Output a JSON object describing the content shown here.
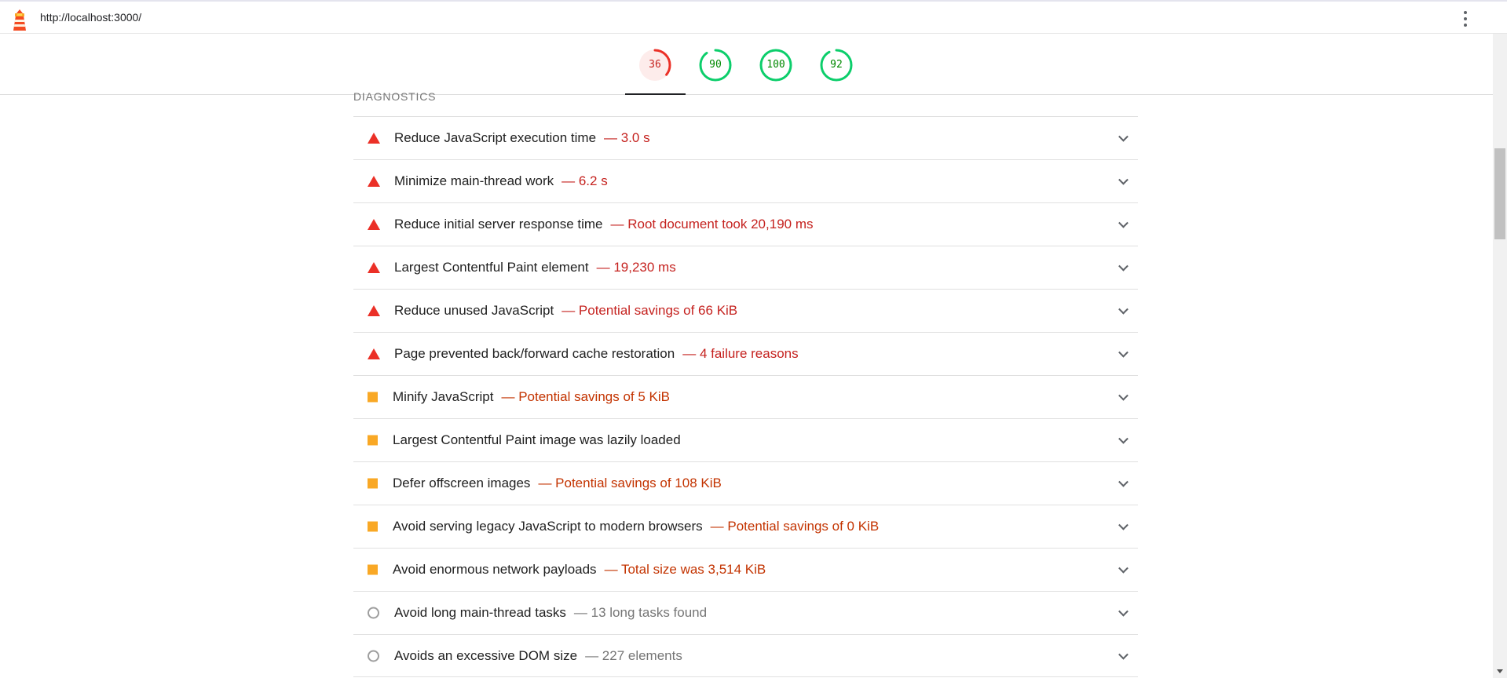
{
  "header": {
    "url": "http://localhost:3000/"
  },
  "scores": [
    {
      "value": "36",
      "fraction": 0.36,
      "status": "fail",
      "color": "#eb3027"
    },
    {
      "value": "90",
      "fraction": 0.9,
      "status": "pass",
      "color": "#0cce6b"
    },
    {
      "value": "100",
      "fraction": 1.0,
      "status": "pass",
      "color": "#0cce6b"
    },
    {
      "value": "92",
      "fraction": 0.92,
      "status": "pass",
      "color": "#0cce6b"
    }
  ],
  "section": {
    "title": "DIAGNOSTICS"
  },
  "audits": [
    {
      "title": "Reduce JavaScript execution time",
      "display": "— 3.0 s",
      "status": "fail",
      "icon": "triangle-fail-icon"
    },
    {
      "title": "Minimize main-thread work",
      "display": "— 6.2 s",
      "status": "fail",
      "icon": "triangle-fail-icon"
    },
    {
      "title": "Reduce initial server response time",
      "display": "— Root document took 20,190 ms",
      "status": "fail",
      "icon": "triangle-fail-icon"
    },
    {
      "title": "Largest Contentful Paint element",
      "display": "— 19,230 ms",
      "status": "fail",
      "icon": "triangle-fail-icon"
    },
    {
      "title": "Reduce unused JavaScript",
      "display": "— Potential savings of 66 KiB",
      "status": "fail",
      "icon": "triangle-fail-icon"
    },
    {
      "title": "Page prevented back/forward cache restoration",
      "display": "— 4 failure reasons",
      "status": "fail",
      "icon": "triangle-fail-icon"
    },
    {
      "title": "Minify JavaScript",
      "display": "— Potential savings of 5 KiB",
      "status": "avg",
      "icon": "square-average-icon"
    },
    {
      "title": "Largest Contentful Paint image was lazily loaded",
      "display": "",
      "status": "avg",
      "icon": "square-average-icon"
    },
    {
      "title": "Defer offscreen images",
      "display": "— Potential savings of 108 KiB",
      "status": "avg",
      "icon": "square-average-icon"
    },
    {
      "title": "Avoid serving legacy JavaScript to modern browsers",
      "display": "— Potential savings of 0 KiB",
      "status": "avg",
      "icon": "square-average-icon"
    },
    {
      "title": "Avoid enormous network payloads",
      "display": "— Total size was 3,514 KiB",
      "status": "avg",
      "icon": "square-average-icon"
    },
    {
      "title": "Avoid long main-thread tasks",
      "display": "— 13 long tasks found",
      "status": "info",
      "icon": "circle-info-icon"
    },
    {
      "title": "Avoids an excessive DOM size",
      "display": "— 227 elements",
      "status": "info",
      "icon": "circle-info-icon"
    }
  ],
  "colors": {
    "fail": "#eb3027",
    "average": "#f9a825",
    "pass": "#0cce6b",
    "fail_text": "#c5221f",
    "average_text": "#c33300",
    "info_text": "#757575"
  }
}
